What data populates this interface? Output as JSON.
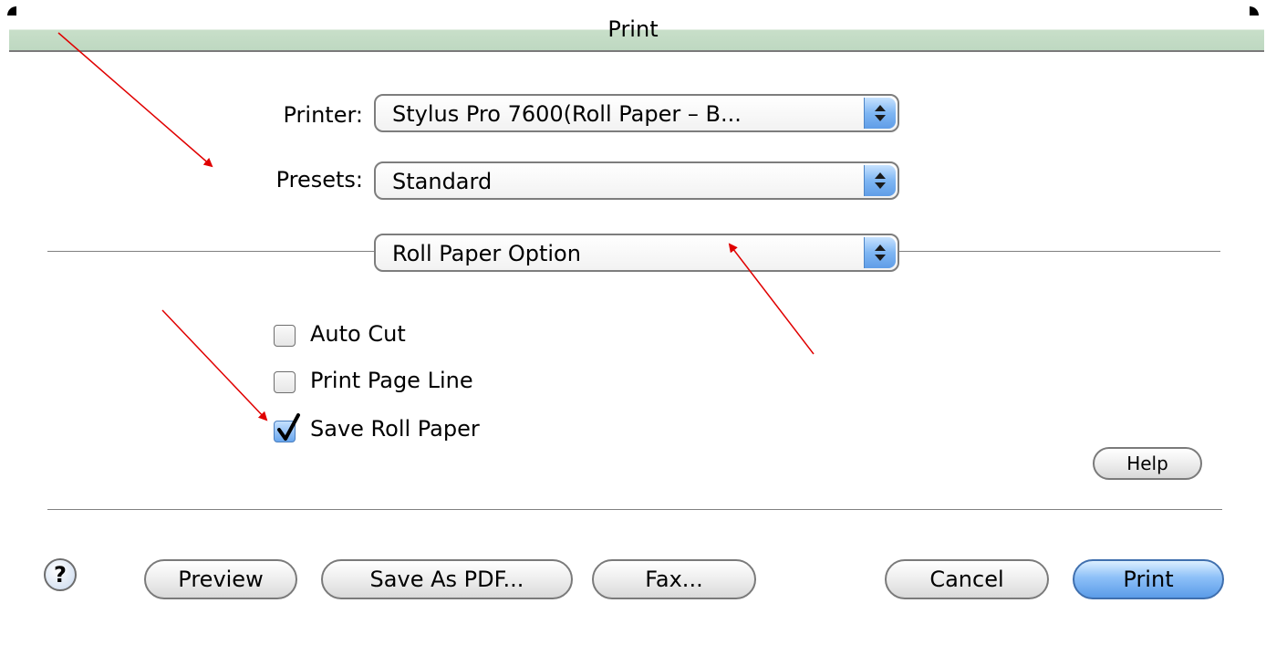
{
  "window": {
    "title": "Print"
  },
  "form": {
    "printer_label": "Printer:",
    "printer_value": "Stylus Pro 7600(Roll Paper – B...",
    "presets_label": "Presets:",
    "presets_value": "Standard",
    "panel_value": "Roll Paper Option"
  },
  "options": [
    {
      "label": "Auto Cut",
      "checked": false
    },
    {
      "label": "Print Page Line",
      "checked": false
    },
    {
      "label": "Save Roll Paper",
      "checked": true
    }
  ],
  "buttons": {
    "help": "Help",
    "question": "?",
    "preview": "Preview",
    "save_pdf": "Save As PDF...",
    "fax": "Fax...",
    "cancel": "Cancel",
    "print": "Print"
  },
  "colors": {
    "titlebar": "#bed8c1",
    "default_button": "#5b9ce8",
    "annotation_arrow": "#e00000"
  }
}
